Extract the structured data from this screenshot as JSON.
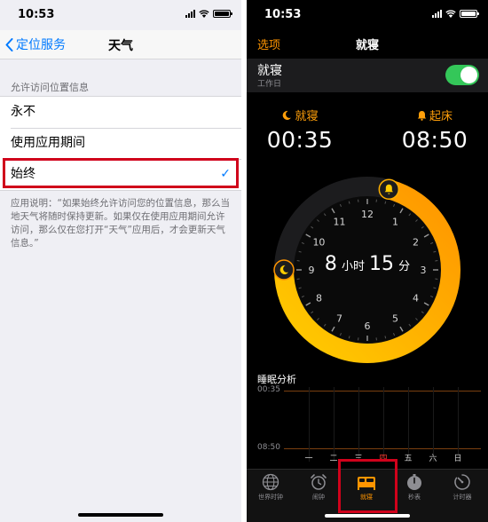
{
  "left": {
    "status": {
      "time": "10:53"
    },
    "nav": {
      "back_label": "定位服务",
      "title": "天气"
    },
    "section_header": "允许访问位置信息",
    "options": [
      {
        "label": "永不",
        "selected": false
      },
      {
        "label": "使用应用期间",
        "selected": false
      },
      {
        "label": "始终",
        "selected": true
      }
    ],
    "check_glyph": "✓",
    "footnote": "应用说明：“如果始终允许访问您的位置信息，那么当地天气将随时保持更新。如果仅在使用应用期间允许访问，那么仅在您打开“天气”应用后，才会更新天气信息。”"
  },
  "right": {
    "status": {
      "time": "10:53"
    },
    "nav": {
      "options_label": "选项",
      "title": "就寝"
    },
    "schedule": {
      "title": "就寝",
      "subtitle": "工作日",
      "enabled": true
    },
    "bedtime": {
      "label": "就寝",
      "time": "00:35",
      "icon": "moon-icon"
    },
    "wake": {
      "label": "起床",
      "time": "08:50",
      "icon": "bell-icon"
    },
    "clock": {
      "numbers": [
        "12",
        "1",
        "2",
        "3",
        "4",
        "5",
        "6",
        "7",
        "8",
        "9",
        "10",
        "11"
      ],
      "duration_hours": "8",
      "hours_unit": "小时",
      "duration_minutes": "15",
      "minutes_unit": "分"
    },
    "analysis": {
      "title": "睡眠分析",
      "top_label": "00:35",
      "bottom_label": "08:50",
      "days": [
        "一",
        "二",
        "三",
        "四",
        "五",
        "六",
        "日"
      ],
      "today_index": 3
    },
    "tabs": [
      {
        "label": "世界时钟",
        "icon": "globe-icon",
        "active": false
      },
      {
        "label": "闹钟",
        "icon": "alarm-clock-icon",
        "active": false
      },
      {
        "label": "就寝",
        "icon": "bed-icon",
        "active": true
      },
      {
        "label": "秒表",
        "icon": "stopwatch-icon",
        "active": false
      },
      {
        "label": "计时器",
        "icon": "timer-icon",
        "active": false
      }
    ]
  },
  "colors": {
    "ios_blue": "#007aff",
    "accent_orange": "#ff9500",
    "toggle_green": "#34c759",
    "highlight_red": "#d0021b"
  }
}
